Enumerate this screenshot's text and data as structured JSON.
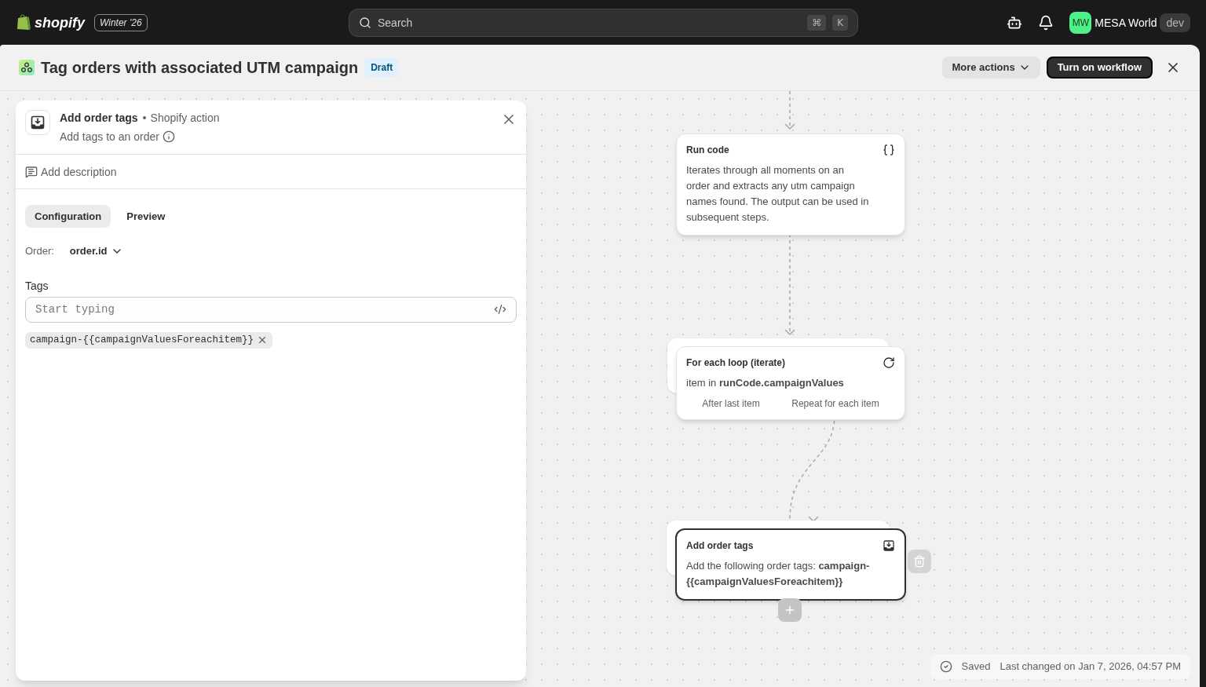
{
  "topbar": {
    "logo_text": "shopify",
    "edition": "Winter '26",
    "search": {
      "placeholder": "Search",
      "keys": [
        "⌘",
        "K"
      ]
    },
    "user": {
      "initials": "MW",
      "name": "MESA World",
      "badge": "dev"
    }
  },
  "header": {
    "title": "Tag orders with associated UTM campaign",
    "status": "Draft",
    "more_actions": "More actions",
    "primary_button": "Turn on workflow"
  },
  "panel": {
    "title": "Add order tags",
    "subtitle": "Shopify action",
    "description": "Add tags to an order",
    "add_description": "Add description",
    "tabs": [
      {
        "label": "Configuration",
        "selected": true
      },
      {
        "label": "Preview",
        "selected": false
      }
    ],
    "order_label": "Order:",
    "order_value": "order.id",
    "tags_label": "Tags",
    "tags_placeholder": "Start typing",
    "tags": [
      "campaign-{{campaignValuesForeachitem}}"
    ]
  },
  "nodes": [
    {
      "kind": "code",
      "title": "Run code",
      "body": "Iterates through all moments on an order and extracts any utm campaign names found. The output can be used in subsequent steps.",
      "selected": false
    },
    {
      "kind": "loop",
      "title": "For each loop (iterate)",
      "body": "item in **runCode.campaignValues**",
      "branches": [
        "After last item",
        "Repeat for each item"
      ],
      "selected": false
    },
    {
      "kind": "action",
      "title": "Add order tags",
      "body": "Add the following order tags: **campaign-{{campaignValuesForeachitem}}**",
      "selected": true
    }
  ],
  "status_bar": {
    "state": "Saved",
    "last_changed": "Last changed on Jan 7, 2026, 04:57 PM"
  }
}
